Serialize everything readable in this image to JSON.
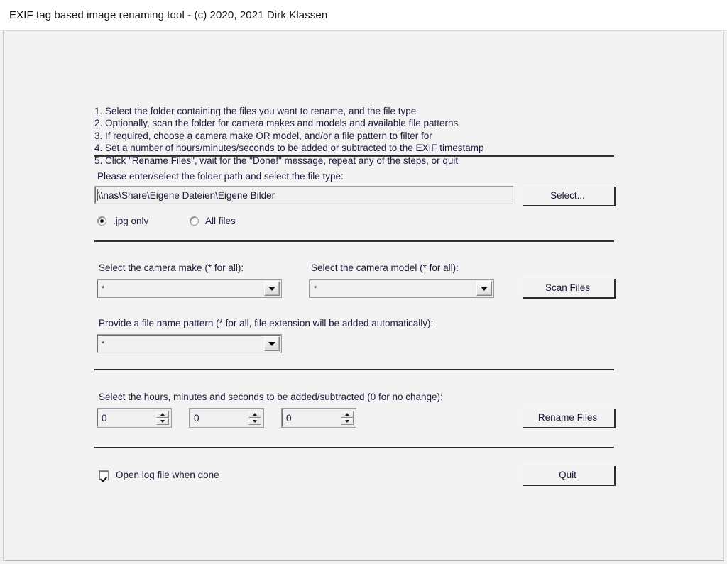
{
  "window": {
    "title": "EXIF tag based image renaming tool - (c) 2020, 2021 Dirk Klassen"
  },
  "instructions": [
    "1. Select the folder containing the files you want to rename, and the file type",
    "2. Optionally, scan the folder for camera makes and models and available file patterns",
    "3. If required, choose a camera make OR model, and/or a file pattern to filter for",
    "4. Set a number of hours/minutes/seconds to be added or subtracted to the EXIF timestamp",
    "5. Click \"Rename Files\", wait for the \"Done!\" message, repeat any of the steps, or quit"
  ],
  "folder_section": {
    "label": "Please enter/select the folder path and select the file type:",
    "path_value": "\\\\nas\\Share\\Eigene Dateien\\Eigene Bilder",
    "select_button": "Select...",
    "filetype_options": [
      {
        "label": ".jpg only",
        "selected": true
      },
      {
        "label": "All files",
        "selected": false
      }
    ]
  },
  "camera_section": {
    "make_label": "Select the camera make (* for all):",
    "make_value": "*",
    "model_label": "Select the camera model (* for all):",
    "model_value": "*",
    "scan_button": "Scan Files"
  },
  "pattern_section": {
    "label": "Provide a file name pattern (* for all, file extension will be added automatically):",
    "value": "*"
  },
  "time_section": {
    "label": "Select the hours, minutes and seconds to be added/subtracted (0 for no change):",
    "hours_value": "0",
    "minutes_value": "0",
    "seconds_value": "0",
    "rename_button": "Rename Files"
  },
  "footer": {
    "open_log_label": "Open log file when done",
    "open_log_checked": true,
    "quit_button": "Quit"
  },
  "colors": {
    "text": "#1b1b3a",
    "window_bg": "#f3f3f3",
    "titlebar_bg": "#ffffff",
    "separator": "#3c3c3c"
  }
}
